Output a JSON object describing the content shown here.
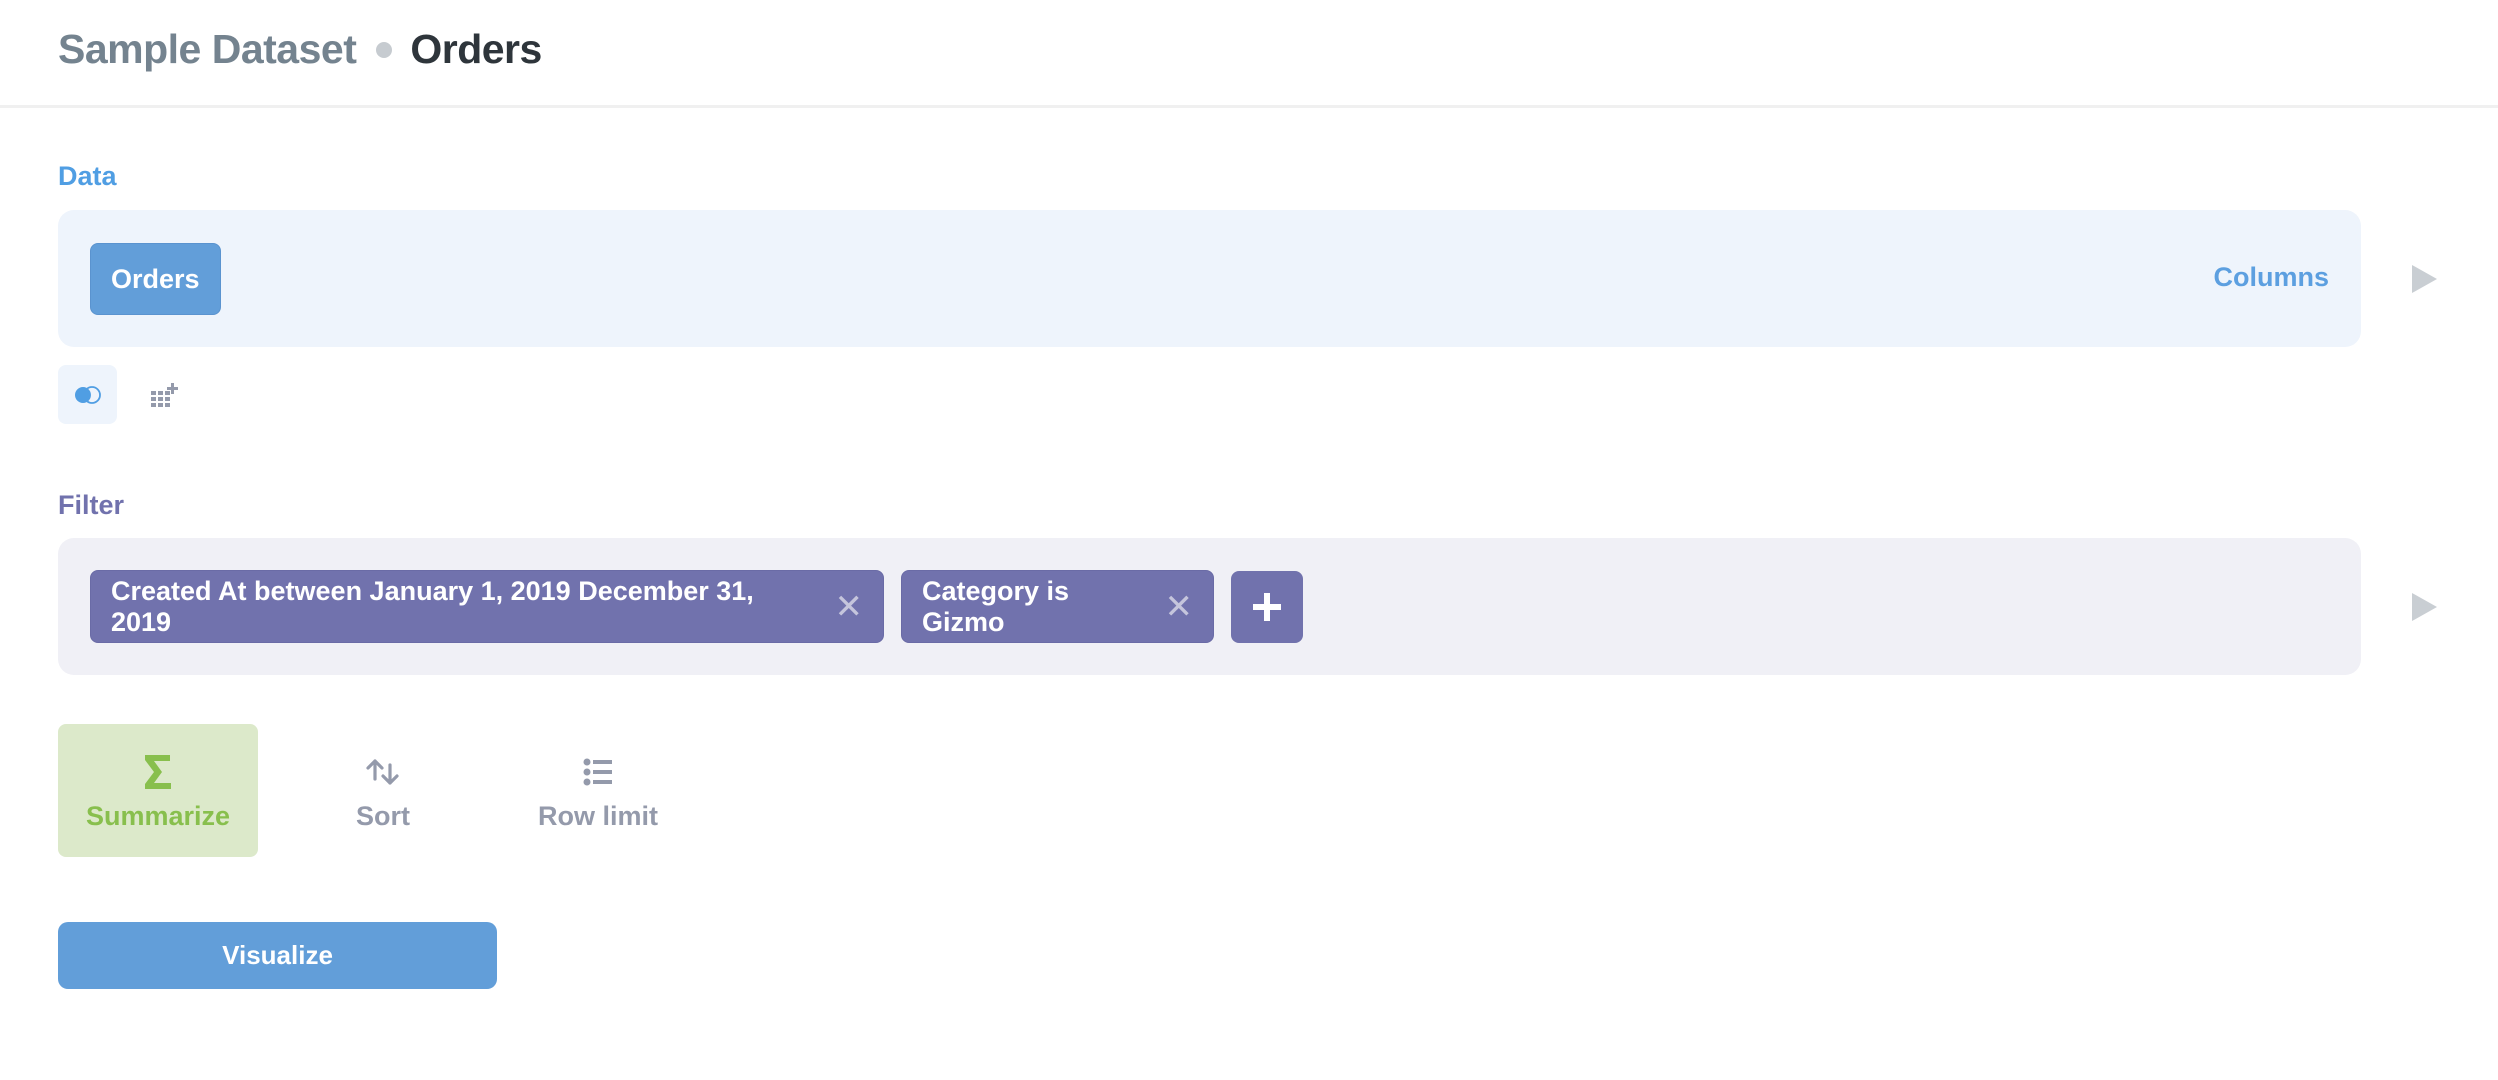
{
  "header": {
    "database": "Sample Dataset",
    "table": "Orders"
  },
  "data_section": {
    "label": "Data",
    "table_chip": "Orders",
    "columns_link": "Columns",
    "actions": [
      {
        "icon": "join-icon"
      },
      {
        "icon": "custom-column-icon"
      }
    ]
  },
  "filter_section": {
    "label": "Filter",
    "filters": [
      {
        "label": "Created At between January 1, 2019 December 31, 2019",
        "remove_icon": "close-icon"
      },
      {
        "label": "Category is Gizmo",
        "remove_icon": "close-icon"
      }
    ],
    "add_icon": "plus-icon"
  },
  "steps": [
    {
      "label": "Summarize",
      "icon": "sigma-icon",
      "active": true
    },
    {
      "label": "Sort",
      "icon": "sort-arrows-icon",
      "active": false
    },
    {
      "label": "Row limit",
      "icon": "list-icon",
      "active": false
    }
  ],
  "visualize_button": "Visualize",
  "colors": {
    "data_accent": "#509ee3",
    "filter_accent": "#7172ad",
    "summarize_accent": "#88bf4d",
    "muted": "#949aab"
  }
}
